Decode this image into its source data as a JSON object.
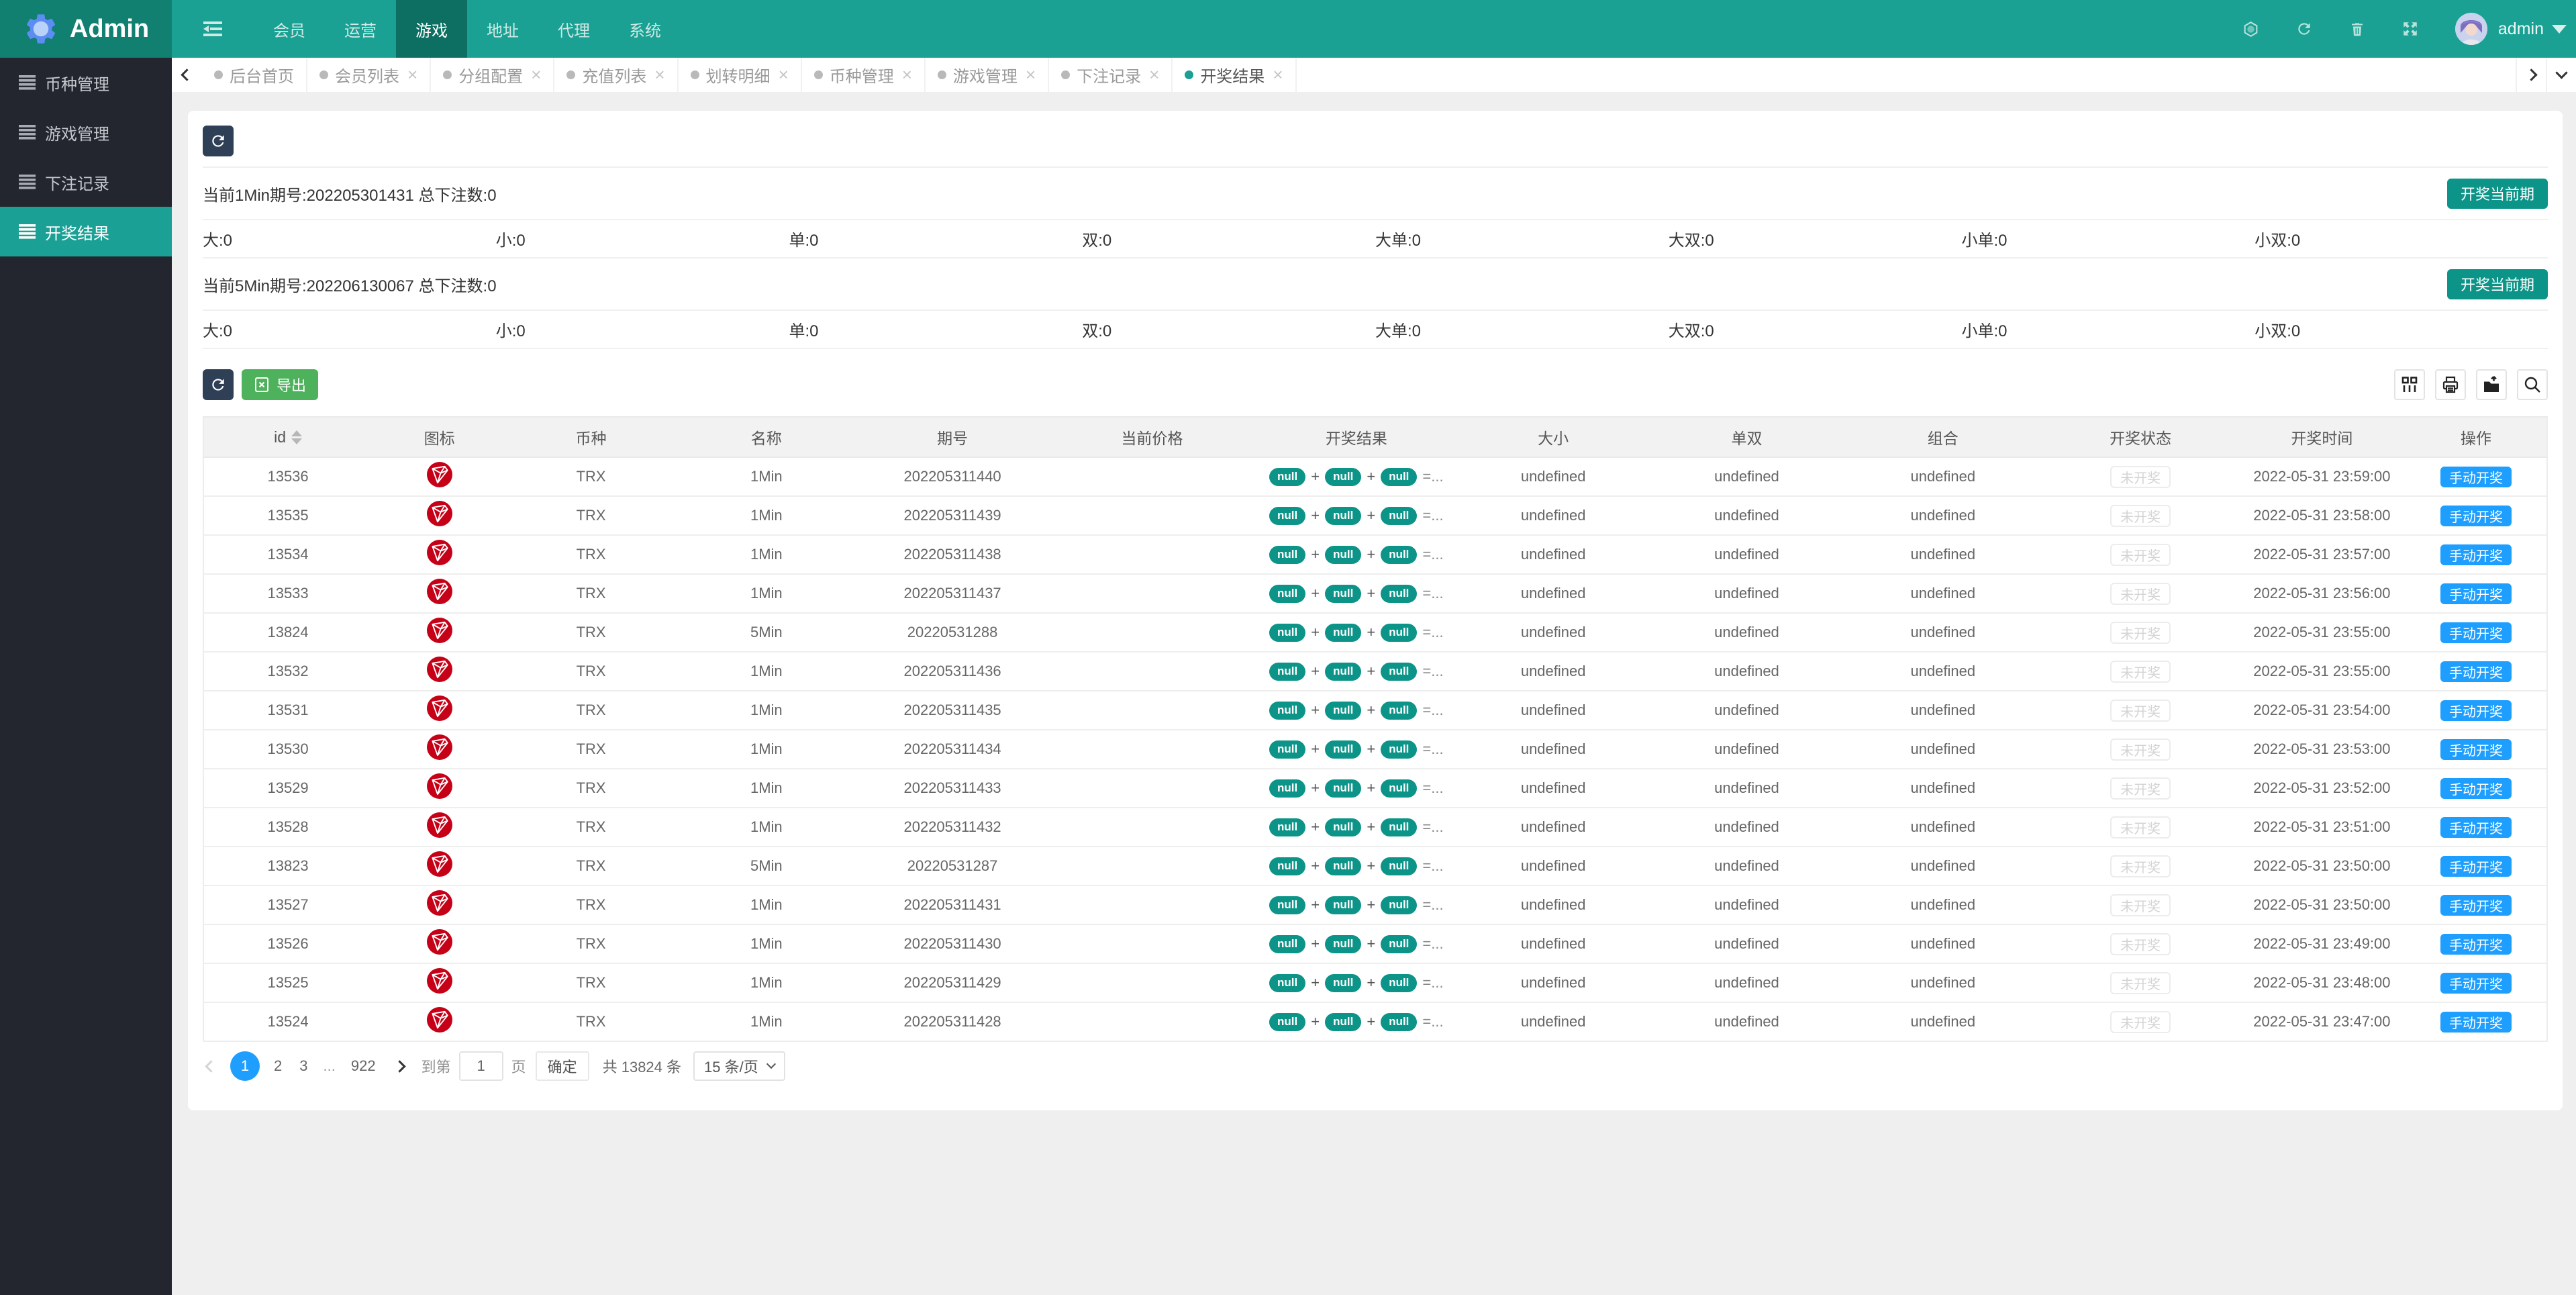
{
  "brand": {
    "title": "Admin"
  },
  "nav": {
    "items": [
      "会员",
      "运营",
      "游戏",
      "地址",
      "代理",
      "系统"
    ],
    "active_index": 2,
    "user": "admin"
  },
  "sidebar": {
    "items": [
      "币种管理",
      "游戏管理",
      "下注记录",
      "开奖结果"
    ],
    "active_index": 3
  },
  "tabs": {
    "items": [
      {
        "label": "后台首页",
        "closable": false
      },
      {
        "label": "会员列表",
        "closable": true
      },
      {
        "label": "分组配置",
        "closable": true
      },
      {
        "label": "充值列表",
        "closable": true
      },
      {
        "label": "划转明细",
        "closable": true
      },
      {
        "label": "币种管理",
        "closable": true
      },
      {
        "label": "游戏管理",
        "closable": true
      },
      {
        "label": "下注记录",
        "closable": true
      },
      {
        "label": "开奖结果",
        "closable": true
      }
    ],
    "active_index": 8
  },
  "panel": {
    "periods": [
      {
        "label": "当前1Min期号:202205301431 总下注数:0",
        "button": "开奖当前期"
      },
      {
        "label": "当前5Min期号:202206130067 总下注数:0",
        "button": "开奖当前期"
      }
    ],
    "stats": [
      "大:0",
      "小:0",
      "单:0",
      "双:0",
      "大单:0",
      "大双:0",
      "小单:0",
      "小双:0"
    ]
  },
  "toolbar": {
    "export_label": "导出"
  },
  "table": {
    "columns": [
      "id",
      "图标",
      "币种",
      "名称",
      "期号",
      "当前价格",
      "开奖结果",
      "大小",
      "单双",
      "组合",
      "开奖状态",
      "开奖时间",
      "操作"
    ],
    "rows": [
      {
        "id": "13536",
        "coin": "TRX",
        "name": "1Min",
        "period": "202205311440",
        "price": "",
        "result": [
          "null",
          "null",
          "null"
        ],
        "result_suffix": "=...",
        "size": "undefined",
        "parity": "undefined",
        "combo": "undefined",
        "status": "未开奖",
        "time": "2022-05-31 23:59:00",
        "action": "手动开奖"
      },
      {
        "id": "13535",
        "coin": "TRX",
        "name": "1Min",
        "period": "202205311439",
        "price": "",
        "result": [
          "null",
          "null",
          "null"
        ],
        "result_suffix": "=...",
        "size": "undefined",
        "parity": "undefined",
        "combo": "undefined",
        "status": "未开奖",
        "time": "2022-05-31 23:58:00",
        "action": "手动开奖"
      },
      {
        "id": "13534",
        "coin": "TRX",
        "name": "1Min",
        "period": "202205311438",
        "price": "",
        "result": [
          "null",
          "null",
          "null"
        ],
        "result_suffix": "=...",
        "size": "undefined",
        "parity": "undefined",
        "combo": "undefined",
        "status": "未开奖",
        "time": "2022-05-31 23:57:00",
        "action": "手动开奖"
      },
      {
        "id": "13533",
        "coin": "TRX",
        "name": "1Min",
        "period": "202205311437",
        "price": "",
        "result": [
          "null",
          "null",
          "null"
        ],
        "result_suffix": "=...",
        "size": "undefined",
        "parity": "undefined",
        "combo": "undefined",
        "status": "未开奖",
        "time": "2022-05-31 23:56:00",
        "action": "手动开奖"
      },
      {
        "id": "13824",
        "coin": "TRX",
        "name": "5Min",
        "period": "20220531288",
        "price": "",
        "result": [
          "null",
          "null",
          "null"
        ],
        "result_suffix": "=...",
        "size": "undefined",
        "parity": "undefined",
        "combo": "undefined",
        "status": "未开奖",
        "time": "2022-05-31 23:55:00",
        "action": "手动开奖"
      },
      {
        "id": "13532",
        "coin": "TRX",
        "name": "1Min",
        "period": "202205311436",
        "price": "",
        "result": [
          "null",
          "null",
          "null"
        ],
        "result_suffix": "=...",
        "size": "undefined",
        "parity": "undefined",
        "combo": "undefined",
        "status": "未开奖",
        "time": "2022-05-31 23:55:00",
        "action": "手动开奖"
      },
      {
        "id": "13531",
        "coin": "TRX",
        "name": "1Min",
        "period": "202205311435",
        "price": "",
        "result": [
          "null",
          "null",
          "null"
        ],
        "result_suffix": "=...",
        "size": "undefined",
        "parity": "undefined",
        "combo": "undefined",
        "status": "未开奖",
        "time": "2022-05-31 23:54:00",
        "action": "手动开奖"
      },
      {
        "id": "13530",
        "coin": "TRX",
        "name": "1Min",
        "period": "202205311434",
        "price": "",
        "result": [
          "null",
          "null",
          "null"
        ],
        "result_suffix": "=...",
        "size": "undefined",
        "parity": "undefined",
        "combo": "undefined",
        "status": "未开奖",
        "time": "2022-05-31 23:53:00",
        "action": "手动开奖"
      },
      {
        "id": "13529",
        "coin": "TRX",
        "name": "1Min",
        "period": "202205311433",
        "price": "",
        "result": [
          "null",
          "null",
          "null"
        ],
        "result_suffix": "=...",
        "size": "undefined",
        "parity": "undefined",
        "combo": "undefined",
        "status": "未开奖",
        "time": "2022-05-31 23:52:00",
        "action": "手动开奖"
      },
      {
        "id": "13528",
        "coin": "TRX",
        "name": "1Min",
        "period": "202205311432",
        "price": "",
        "result": [
          "null",
          "null",
          "null"
        ],
        "result_suffix": "=...",
        "size": "undefined",
        "parity": "undefined",
        "combo": "undefined",
        "status": "未开奖",
        "time": "2022-05-31 23:51:00",
        "action": "手动开奖"
      },
      {
        "id": "13823",
        "coin": "TRX",
        "name": "5Min",
        "period": "20220531287",
        "price": "",
        "result": [
          "null",
          "null",
          "null"
        ],
        "result_suffix": "=...",
        "size": "undefined",
        "parity": "undefined",
        "combo": "undefined",
        "status": "未开奖",
        "time": "2022-05-31 23:50:00",
        "action": "手动开奖"
      },
      {
        "id": "13527",
        "coin": "TRX",
        "name": "1Min",
        "period": "202205311431",
        "price": "",
        "result": [
          "null",
          "null",
          "null"
        ],
        "result_suffix": "=...",
        "size": "undefined",
        "parity": "undefined",
        "combo": "undefined",
        "status": "未开奖",
        "time": "2022-05-31 23:50:00",
        "action": "手动开奖"
      },
      {
        "id": "13526",
        "coin": "TRX",
        "name": "1Min",
        "period": "202205311430",
        "price": "",
        "result": [
          "null",
          "null",
          "null"
        ],
        "result_suffix": "=...",
        "size": "undefined",
        "parity": "undefined",
        "combo": "undefined",
        "status": "未开奖",
        "time": "2022-05-31 23:49:00",
        "action": "手动开奖"
      },
      {
        "id": "13525",
        "coin": "TRX",
        "name": "1Min",
        "period": "202205311429",
        "price": "",
        "result": [
          "null",
          "null",
          "null"
        ],
        "result_suffix": "=...",
        "size": "undefined",
        "parity": "undefined",
        "combo": "undefined",
        "status": "未开奖",
        "time": "2022-05-31 23:48:00",
        "action": "手动开奖"
      },
      {
        "id": "13524",
        "coin": "TRX",
        "name": "1Min",
        "period": "202205311428",
        "price": "",
        "result": [
          "null",
          "null",
          "null"
        ],
        "result_suffix": "=...",
        "size": "undefined",
        "parity": "undefined",
        "combo": "undefined",
        "status": "未开奖",
        "time": "2022-05-31 23:47:00",
        "action": "手动开奖"
      }
    ]
  },
  "pagination": {
    "pages": [
      "1",
      "2",
      "3",
      "...",
      "922"
    ],
    "current": "1",
    "goto_label": "到第",
    "goto_value": "1",
    "page_suffix": "页",
    "confirm_label": "确定",
    "total_label": "共 13824 条",
    "per_page_label": "15 条/页"
  },
  "colors": {
    "navbar": "#1aa194",
    "logo_bg": "#128070",
    "nav_active": "#0d6e62",
    "sidebar": "#23262e",
    "accent_teal": "#1aa094",
    "button_teal": "#0c9488",
    "button_dark": "#2f4056",
    "button_green": "#4eb15c",
    "button_blue": "#1e9fff",
    "tron_red": "#c50017"
  }
}
